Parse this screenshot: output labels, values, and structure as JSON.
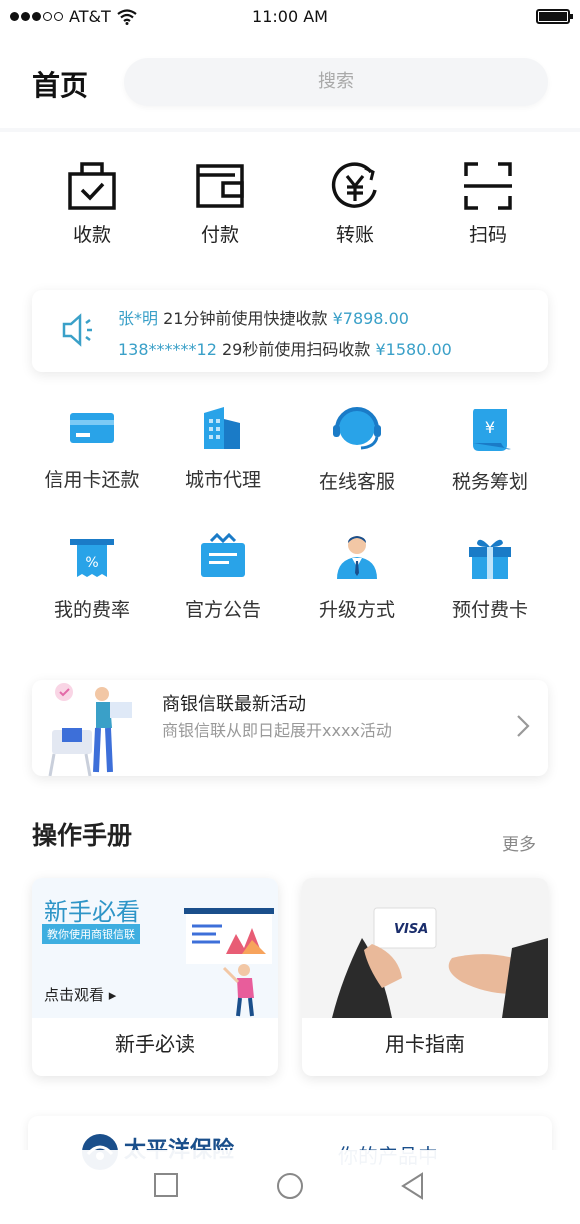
{
  "status": {
    "carrier": "AT&T",
    "time": "11:00 AM"
  },
  "header": {
    "title": "首页",
    "search_placeholder": "搜索"
  },
  "quick_actions": [
    {
      "label": "收款",
      "icon": "receive-bag-icon"
    },
    {
      "label": "付款",
      "icon": "wallet-icon"
    },
    {
      "label": "转账",
      "icon": "yuan-transfer-icon"
    },
    {
      "label": "扫码",
      "icon": "scan-icon"
    }
  ],
  "notices": [
    {
      "user": "张*明",
      "text": "21分钟前使用快捷收款",
      "amount": "¥7898.00"
    },
    {
      "user": "138******12",
      "text": "29秒前使用扫码收款",
      "amount": "¥1580.00"
    }
  ],
  "services": [
    {
      "label": "信用卡还款",
      "icon": "credit-card-icon"
    },
    {
      "label": "城市代理",
      "icon": "building-icon"
    },
    {
      "label": "在线客服",
      "icon": "headset-icon"
    },
    {
      "label": "税务筹划",
      "icon": "tax-scroll-icon"
    },
    {
      "label": "我的费率",
      "icon": "rate-receipt-icon"
    },
    {
      "label": "官方公告",
      "icon": "announcement-box-icon"
    },
    {
      "label": "升级方式",
      "icon": "businessman-icon"
    },
    {
      "label": "预付费卡",
      "icon": "gift-card-icon"
    }
  ],
  "promo": {
    "title": "商银信联最新活动",
    "desc": "商银信联从即日起展开xxxx活动"
  },
  "manual": {
    "title": "操作手册",
    "more": "更多",
    "cards": [
      {
        "caption": "新手必读",
        "banner_title": "新手必看",
        "banner_sub": "教你使用商银信联",
        "banner_cta": "点击观看"
      },
      {
        "caption": "用卡指南",
        "card_brand": "VISA"
      }
    ]
  },
  "bottom_banner": {
    "logo_text": "太平洋保险",
    "right_text": "你的产品中"
  },
  "colors": {
    "accent": "#3aa0c8",
    "icon_blue": "#1e8fe0",
    "text_dark": "#222222"
  }
}
